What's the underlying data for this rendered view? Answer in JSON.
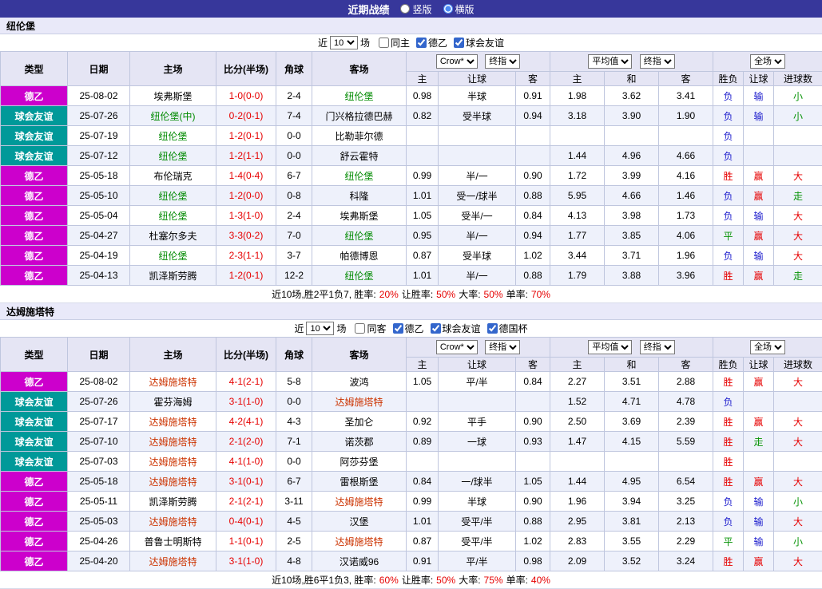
{
  "topbar": {
    "title": "近期战绩",
    "radios": [
      {
        "label": "竖版",
        "selected": false
      },
      {
        "label": "横版",
        "selected": true
      }
    ]
  },
  "colors": {
    "score": "#e60000",
    "summary_highlight": "#e60000",
    "type_badges": {
      "德乙": "#cc00cc",
      "球会友谊": "#009999"
    },
    "results": {
      "r": "#e60000",
      "b": "#1a1acc",
      "g": "#089408"
    }
  },
  "sections": [
    {
      "team": "纽伦堡",
      "team_color": "#008a00",
      "filter": {
        "near_label": "近",
        "count": "10",
        "games_label": "场",
        "checkboxes": [
          {
            "label": "同主",
            "checked": false
          },
          {
            "label": "德乙",
            "checked": true
          },
          {
            "label": "球会友谊",
            "checked": true
          }
        ]
      },
      "header": {
        "type": "类型",
        "date": "日期",
        "home": "主场",
        "score": "比分(半场)",
        "corner": "角球",
        "away": "客场",
        "odds_source": "Crow*",
        "odds_final": "终指",
        "avg_source": "平均值",
        "avg_final": "终指",
        "full": "全场",
        "odds_cols": [
          "主",
          "让球",
          "客"
        ],
        "avg_cols": [
          "主",
          "和",
          "客"
        ],
        "result_cols": [
          "胜负",
          "让球",
          "进球数"
        ]
      },
      "rows": [
        {
          "type": "德乙",
          "date": "25-08-02",
          "home": "埃弗斯堡",
          "home_hl": false,
          "score": "1-0(0-0)",
          "corner": "2-4",
          "away": "纽伦堡",
          "away_hl": true,
          "odds": [
            "0.98",
            "半球",
            "0.91"
          ],
          "avg": [
            "1.98",
            "3.62",
            "3.41"
          ],
          "res": [
            [
              "负",
              "b"
            ],
            [
              "输",
              "b"
            ],
            [
              "小",
              "g"
            ]
          ]
        },
        {
          "type": "球会友谊",
          "date": "25-07-26",
          "home": "纽伦堡(中)",
          "home_hl": true,
          "score": "0-2(0-1)",
          "corner": "7-4",
          "away": "门兴格拉德巴赫",
          "away_hl": false,
          "odds": [
            "0.82",
            "受半球",
            "0.94"
          ],
          "avg": [
            "3.18",
            "3.90",
            "1.90"
          ],
          "res": [
            [
              "负",
              "b"
            ],
            [
              "输",
              "b"
            ],
            [
              "小",
              "g"
            ]
          ]
        },
        {
          "type": "球会友谊",
          "date": "25-07-19",
          "home": "纽伦堡",
          "home_hl": true,
          "score": "1-2(0-1)",
          "corner": "0-0",
          "away": "比勒菲尔德",
          "away_hl": false,
          "odds": [
            "",
            "",
            ""
          ],
          "avg": [
            "",
            "",
            ""
          ],
          "res": [
            [
              "负",
              "b"
            ],
            [
              "",
              ""
            ],
            [
              "",
              ""
            ]
          ]
        },
        {
          "type": "球会友谊",
          "date": "25-07-12",
          "home": "纽伦堡",
          "home_hl": true,
          "score": "1-2(1-1)",
          "corner": "0-0",
          "away": "舒云霍特",
          "away_hl": false,
          "odds": [
            "",
            "",
            ""
          ],
          "avg": [
            "1.44",
            "4.96",
            "4.66"
          ],
          "res": [
            [
              "负",
              "b"
            ],
            [
              "",
              ""
            ],
            [
              "",
              ""
            ]
          ]
        },
        {
          "type": "德乙",
          "date": "25-05-18",
          "home": "布伦瑞克",
          "home_hl": false,
          "score": "1-4(0-4)",
          "corner": "6-7",
          "away": "纽伦堡",
          "away_hl": true,
          "odds": [
            "0.99",
            "半/一",
            "0.90"
          ],
          "avg": [
            "1.72",
            "3.99",
            "4.16"
          ],
          "res": [
            [
              "胜",
              "r"
            ],
            [
              "赢",
              "r"
            ],
            [
              "大",
              "r"
            ]
          ]
        },
        {
          "type": "德乙",
          "date": "25-05-10",
          "home": "纽伦堡",
          "home_hl": true,
          "score": "1-2(0-0)",
          "corner": "0-8",
          "away": "科隆",
          "away_hl": false,
          "odds": [
            "1.01",
            "受一/球半",
            "0.88"
          ],
          "avg": [
            "5.95",
            "4.66",
            "1.46"
          ],
          "res": [
            [
              "负",
              "b"
            ],
            [
              "赢",
              "r"
            ],
            [
              "走",
              "g"
            ]
          ]
        },
        {
          "type": "德乙",
          "date": "25-05-04",
          "home": "纽伦堡",
          "home_hl": true,
          "score": "1-3(1-0)",
          "corner": "2-4",
          "away": "埃弗斯堡",
          "away_hl": false,
          "odds": [
            "1.05",
            "受半/一",
            "0.84"
          ],
          "avg": [
            "4.13",
            "3.98",
            "1.73"
          ],
          "res": [
            [
              "负",
              "b"
            ],
            [
              "输",
              "b"
            ],
            [
              "大",
              "r"
            ]
          ]
        },
        {
          "type": "德乙",
          "date": "25-04-27",
          "home": "杜塞尔多夫",
          "home_hl": false,
          "score": "3-3(0-2)",
          "corner": "7-0",
          "away": "纽伦堡",
          "away_hl": true,
          "odds": [
            "0.95",
            "半/一",
            "0.94"
          ],
          "avg": [
            "1.77",
            "3.85",
            "4.06"
          ],
          "res": [
            [
              "平",
              "g"
            ],
            [
              "赢",
              "r"
            ],
            [
              "大",
              "r"
            ]
          ]
        },
        {
          "type": "德乙",
          "date": "25-04-19",
          "home": "纽伦堡",
          "home_hl": true,
          "score": "2-3(1-1)",
          "corner": "3-7",
          "away": "帕德博恩",
          "away_hl": false,
          "odds": [
            "0.87",
            "受半球",
            "1.02"
          ],
          "avg": [
            "3.44",
            "3.71",
            "1.96"
          ],
          "res": [
            [
              "负",
              "b"
            ],
            [
              "输",
              "b"
            ],
            [
              "大",
              "r"
            ]
          ]
        },
        {
          "type": "德乙",
          "date": "25-04-13",
          "home": "凯泽斯劳腾",
          "home_hl": false,
          "score": "1-2(0-1)",
          "corner": "12-2",
          "away": "纽伦堡",
          "away_hl": true,
          "odds": [
            "1.01",
            "半/一",
            "0.88"
          ],
          "avg": [
            "1.79",
            "3.88",
            "3.96"
          ],
          "res": [
            [
              "胜",
              "r"
            ],
            [
              "赢",
              "r"
            ],
            [
              "走",
              "g"
            ]
          ]
        }
      ],
      "summary": [
        [
          "近10场,胜2平1负7, 胜率:",
          "k"
        ],
        [
          "20%",
          "r"
        ],
        [
          " 让胜率:",
          "k"
        ],
        [
          "50%",
          "r"
        ],
        [
          " 大率:",
          "k"
        ],
        [
          "50%",
          "r"
        ],
        [
          " 单率:",
          "k"
        ],
        [
          "70%",
          "r"
        ]
      ]
    },
    {
      "team": "达姆施塔特",
      "team_color": "#cc3300",
      "filter": {
        "near_label": "近",
        "count": "10",
        "games_label": "场",
        "checkboxes": [
          {
            "label": "同客",
            "checked": false
          },
          {
            "label": "德乙",
            "checked": true
          },
          {
            "label": "球会友谊",
            "checked": true
          },
          {
            "label": "德国杯",
            "checked": true
          }
        ]
      },
      "header": {
        "type": "类型",
        "date": "日期",
        "home": "主场",
        "score": "比分(半场)",
        "corner": "角球",
        "away": "客场",
        "odds_source": "Crow*",
        "odds_final": "终指",
        "avg_source": "平均值",
        "avg_final": "终指",
        "full": "全场",
        "odds_cols": [
          "主",
          "让球",
          "客"
        ],
        "avg_cols": [
          "主",
          "和",
          "客"
        ],
        "result_cols": [
          "胜负",
          "让球",
          "进球数"
        ]
      },
      "rows": [
        {
          "type": "德乙",
          "date": "25-08-02",
          "home": "达姆施塔特",
          "home_hl": true,
          "score": "4-1(2-1)",
          "corner": "5-8",
          "away": "波鸿",
          "away_hl": false,
          "odds": [
            "1.05",
            "平/半",
            "0.84"
          ],
          "avg": [
            "2.27",
            "3.51",
            "2.88"
          ],
          "res": [
            [
              "胜",
              "r"
            ],
            [
              "赢",
              "r"
            ],
            [
              "大",
              "r"
            ]
          ]
        },
        {
          "type": "球会友谊",
          "date": "25-07-26",
          "home": "霍芬海姆",
          "home_hl": false,
          "score": "3-1(1-0)",
          "corner": "0-0",
          "away": "达姆施塔特",
          "away_hl": true,
          "odds": [
            "",
            "",
            ""
          ],
          "avg": [
            "1.52",
            "4.71",
            "4.78"
          ],
          "res": [
            [
              "负",
              "b"
            ],
            [
              "",
              ""
            ],
            [
              "",
              ""
            ]
          ]
        },
        {
          "type": "球会友谊",
          "date": "25-07-17",
          "home": "达姆施塔特",
          "home_hl": true,
          "score": "4-2(4-1)",
          "corner": "4-3",
          "away": "圣加仑",
          "away_hl": false,
          "odds": [
            "0.92",
            "平手",
            "0.90"
          ],
          "avg": [
            "2.50",
            "3.69",
            "2.39"
          ],
          "res": [
            [
              "胜",
              "r"
            ],
            [
              "赢",
              "r"
            ],
            [
              "大",
              "r"
            ]
          ]
        },
        {
          "type": "球会友谊",
          "date": "25-07-10",
          "home": "达姆施塔特",
          "home_hl": true,
          "score": "2-1(2-0)",
          "corner": "7-1",
          "away": "诺茨郡",
          "away_hl": false,
          "odds": [
            "0.89",
            "一球",
            "0.93"
          ],
          "avg": [
            "1.47",
            "4.15",
            "5.59"
          ],
          "res": [
            [
              "胜",
              "r"
            ],
            [
              "走",
              "g"
            ],
            [
              "大",
              "r"
            ]
          ]
        },
        {
          "type": "球会友谊",
          "date": "25-07-03",
          "home": "达姆施塔特",
          "home_hl": true,
          "score": "4-1(1-0)",
          "corner": "0-0",
          "away": "阿莎芬堡",
          "away_hl": false,
          "odds": [
            "",
            "",
            ""
          ],
          "avg": [
            "",
            "",
            ""
          ],
          "res": [
            [
              "胜",
              "r"
            ],
            [
              "",
              ""
            ],
            [
              "",
              ""
            ]
          ]
        },
        {
          "type": "德乙",
          "date": "25-05-18",
          "home": "达姆施塔特",
          "home_hl": true,
          "score": "3-1(0-1)",
          "corner": "6-7",
          "away": "雷根斯堡",
          "away_hl": false,
          "odds": [
            "0.84",
            "一/球半",
            "1.05"
          ],
          "avg": [
            "1.44",
            "4.95",
            "6.54"
          ],
          "res": [
            [
              "胜",
              "r"
            ],
            [
              "赢",
              "r"
            ],
            [
              "大",
              "r"
            ]
          ]
        },
        {
          "type": "德乙",
          "date": "25-05-11",
          "home": "凯泽斯劳腾",
          "home_hl": false,
          "score": "2-1(2-1)",
          "corner": "3-11",
          "away": "达姆施塔特",
          "away_hl": true,
          "odds": [
            "0.99",
            "半球",
            "0.90"
          ],
          "avg": [
            "1.96",
            "3.94",
            "3.25"
          ],
          "res": [
            [
              "负",
              "b"
            ],
            [
              "输",
              "b"
            ],
            [
              "小",
              "g"
            ]
          ]
        },
        {
          "type": "德乙",
          "date": "25-05-03",
          "home": "达姆施塔特",
          "home_hl": true,
          "score": "0-4(0-1)",
          "corner": "4-5",
          "away": "汉堡",
          "away_hl": false,
          "odds": [
            "1.01",
            "受平/半",
            "0.88"
          ],
          "avg": [
            "2.95",
            "3.81",
            "2.13"
          ],
          "res": [
            [
              "负",
              "b"
            ],
            [
              "输",
              "b"
            ],
            [
              "大",
              "r"
            ]
          ]
        },
        {
          "type": "德乙",
          "date": "25-04-26",
          "home": "普鲁士明斯特",
          "home_hl": false,
          "score": "1-1(0-1)",
          "corner": "2-5",
          "away": "达姆施塔特",
          "away_hl": true,
          "odds": [
            "0.87",
            "受平/半",
            "1.02"
          ],
          "avg": [
            "2.83",
            "3.55",
            "2.29"
          ],
          "res": [
            [
              "平",
              "g"
            ],
            [
              "输",
              "b"
            ],
            [
              "小",
              "g"
            ]
          ]
        },
        {
          "type": "德乙",
          "date": "25-04-20",
          "home": "达姆施塔特",
          "home_hl": true,
          "score": "3-1(1-0)",
          "corner": "4-8",
          "away": "汉诺威96",
          "away_hl": false,
          "odds": [
            "0.91",
            "平/半",
            "0.98"
          ],
          "avg": [
            "2.09",
            "3.52",
            "3.24"
          ],
          "res": [
            [
              "胜",
              "r"
            ],
            [
              "赢",
              "r"
            ],
            [
              "大",
              "r"
            ]
          ]
        }
      ],
      "summary": [
        [
          "近10场,胜6平1负3, 胜率:",
          "k"
        ],
        [
          "60%",
          "r"
        ],
        [
          " 让胜率:",
          "k"
        ],
        [
          "50%",
          "r"
        ],
        [
          " 大率:",
          "k"
        ],
        [
          "75%",
          "r"
        ],
        [
          " 单率:",
          "k"
        ],
        [
          "40%",
          "r"
        ]
      ]
    }
  ]
}
